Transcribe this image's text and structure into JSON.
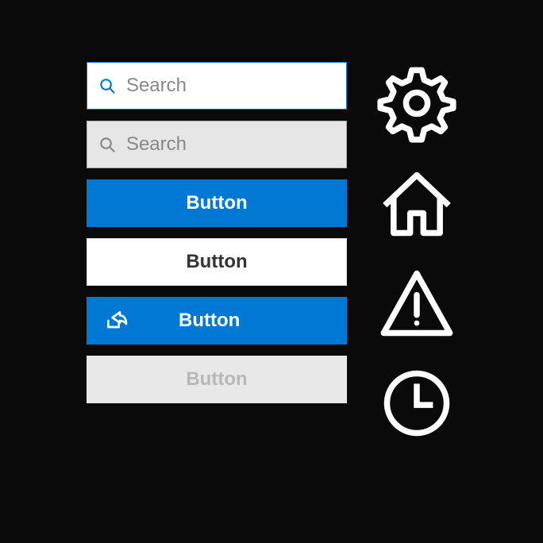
{
  "colors": {
    "accent": "#0078d4",
    "icon": "#ffffff"
  },
  "search": {
    "active_placeholder": "Search",
    "inactive_placeholder": "Search"
  },
  "buttons": {
    "primary_label": "Button",
    "standard_label": "Button",
    "icon_label": "Button",
    "disabled_label": "Button"
  },
  "icons": {
    "settings": "gear-icon",
    "home": "home-icon",
    "warning": "warning-icon",
    "clock": "clock-icon",
    "share": "share-icon",
    "search": "search-icon"
  }
}
